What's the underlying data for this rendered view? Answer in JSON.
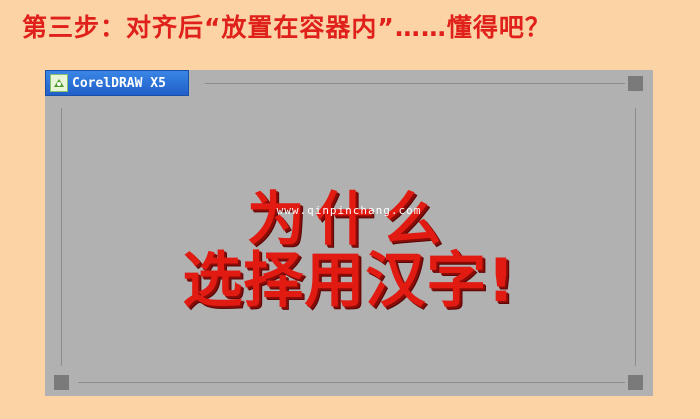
{
  "header": {
    "title": "第三步：对齐后“放置在容器内”……懂得吧？"
  },
  "canvas": {
    "app_badge": {
      "icon": "coreldraw-logo-icon",
      "label": "CorelDRAW X5"
    },
    "headline_line1": "为什么",
    "headline_line2": "选择用汉字!",
    "watermark": "www.qinpinchang.com"
  },
  "colors": {
    "page_background": "#fbd3a4",
    "title_red": "#e0201a",
    "canvas_gray": "#b1b1b1",
    "headline_red": "#e21b12",
    "badge_blue": "#2a6fd6"
  }
}
